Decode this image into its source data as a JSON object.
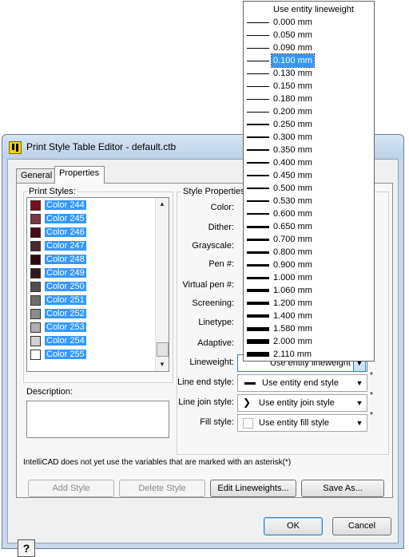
{
  "window": {
    "title": "Print Style Table Editor - default.ctb"
  },
  "tabs": [
    {
      "label": "General"
    },
    {
      "label": "Properties"
    }
  ],
  "print_styles": {
    "label": "Print Styles:",
    "items": [
      {
        "label": "Color 244",
        "color": "#7a0f1e"
      },
      {
        "label": "Color 245",
        "color": "#7a3a44"
      },
      {
        "label": "Color 246",
        "color": "#4a0a14"
      },
      {
        "label": "Color 247",
        "color": "#4a2a30"
      },
      {
        "label": "Color 248",
        "color": "#2e0a10"
      },
      {
        "label": "Color 249",
        "color": "#2e1a1e"
      },
      {
        "label": "Color 250",
        "color": "#505050"
      },
      {
        "label": "Color 251",
        "color": "#6e6e6e"
      },
      {
        "label": "Color 252",
        "color": "#8e8e8e"
      },
      {
        "label": "Color 253",
        "color": "#b0b0b0"
      },
      {
        "label": "Color 254",
        "color": "#d2d2d2"
      },
      {
        "label": "Color 255",
        "color": "#ffffff"
      }
    ]
  },
  "description": {
    "label": "Description:"
  },
  "style_properties": {
    "label": "Style Properties",
    "color_label": "Color:",
    "dither_label": "Dither:",
    "grayscale_label": "Grayscale:",
    "pen_label": "Pen #:",
    "virtual_pen_label": "Virtual pen #:",
    "screening_label": "Screening:",
    "linetype_label": "Linetype:",
    "adaptive_label": "Adaptive:",
    "lineweight_label": "Lineweight:",
    "lineweight_value": "Use entity lineweight",
    "line_end_label": "Line end style:",
    "line_end_value": "Use entity end style",
    "line_join_label": "Line join style:",
    "line_join_value": "Use entity join style",
    "fill_label": "Fill style:",
    "fill_value": "Use entity fill style",
    "asterisk": "*"
  },
  "note": "IntelliCAD does not yet use the variables that are marked with an asterisk(*)",
  "buttons": {
    "add_style": "Add Style",
    "delete_style": "Delete Style",
    "edit_lineweights": "Edit Lineweights...",
    "save_as": "Save As...",
    "ok": "OK",
    "cancel": "Cancel",
    "help": "?"
  },
  "lineweight_dropdown": {
    "items": [
      {
        "label": "Use entity lineweight",
        "weight": 0
      },
      {
        "label": "0.000 mm",
        "weight": 0.0
      },
      {
        "label": "0.050 mm",
        "weight": 0.05
      },
      {
        "label": "0.090 mm",
        "weight": 0.09
      },
      {
        "label": "0.100 mm",
        "weight": 0.1,
        "selected": true
      },
      {
        "label": "0.130 mm",
        "weight": 0.13
      },
      {
        "label": "0.150 mm",
        "weight": 0.15
      },
      {
        "label": "0.180 mm",
        "weight": 0.18
      },
      {
        "label": "0.200 mm",
        "weight": 0.2
      },
      {
        "label": "0.250 mm",
        "weight": 0.25
      },
      {
        "label": "0.300 mm",
        "weight": 0.3
      },
      {
        "label": "0.350 mm",
        "weight": 0.35
      },
      {
        "label": "0.400 mm",
        "weight": 0.4
      },
      {
        "label": "0.450 mm",
        "weight": 0.45
      },
      {
        "label": "0.500 mm",
        "weight": 0.5
      },
      {
        "label": "0.530 mm",
        "weight": 0.53
      },
      {
        "label": "0.600 mm",
        "weight": 0.6
      },
      {
        "label": "0.650 mm",
        "weight": 0.65
      },
      {
        "label": "0.700 mm",
        "weight": 0.7
      },
      {
        "label": "0.800 mm",
        "weight": 0.8
      },
      {
        "label": "0.900 mm",
        "weight": 0.9
      },
      {
        "label": "1.000 mm",
        "weight": 1.0
      },
      {
        "label": "1.060 mm",
        "weight": 1.06
      },
      {
        "label": "1.200 mm",
        "weight": 1.2
      },
      {
        "label": "1.400 mm",
        "weight": 1.4
      },
      {
        "label": "1.580 mm",
        "weight": 1.58
      },
      {
        "label": "2.000 mm",
        "weight": 2.0
      },
      {
        "label": "2.110 mm",
        "weight": 2.11
      }
    ]
  }
}
